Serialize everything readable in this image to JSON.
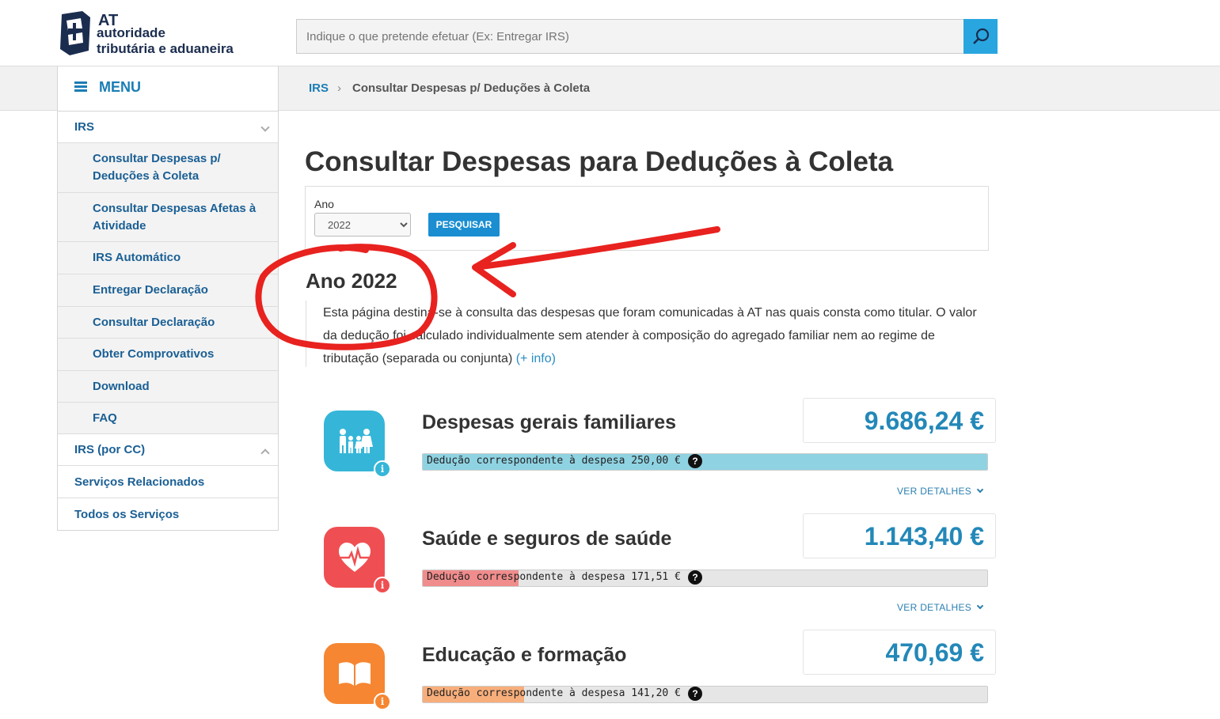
{
  "header": {
    "logo": {
      "abbr": "AT",
      "line1": "autoridade",
      "line2": "tributária e aduaneira"
    },
    "search": {
      "placeholder": "Indique o que pretende efetuar (Ex: Entregar IRS)"
    }
  },
  "breadcrumb": {
    "home": "IRS",
    "separator": "›",
    "current": "Consultar Despesas p/ Deduções à Coleta"
  },
  "sidebar": {
    "menu_label": "MENU",
    "sections": [
      {
        "label": "IRS",
        "expanded": true
      },
      {
        "label": "IRS (por CC)",
        "expanded": false
      },
      {
        "label": "Serviços Relacionados"
      },
      {
        "label": "Todos os Serviços"
      }
    ],
    "irs_items": [
      {
        "label": "Consultar Despesas p/ Deduções à Coleta"
      },
      {
        "label": "Consultar Despesas Afetas à Atividade"
      },
      {
        "label": "IRS Automático"
      },
      {
        "label": "Entregar Declaração"
      },
      {
        "label": "Consultar Declaração"
      },
      {
        "label": "Obter Comprovativos"
      },
      {
        "label": "Download"
      },
      {
        "label": "FAQ"
      }
    ]
  },
  "main": {
    "title": "Consultar Despesas para Deduções à Coleta",
    "filter": {
      "year_label": "Ano",
      "year_value": "2022",
      "search_button": "PESQUISAR"
    },
    "year_heading": "Ano 2022",
    "description": "Esta página destina-se à consulta das despesas que foram comunicadas à AT nas quais consta como titular. O valor da dedução foi calculado individualmente sem atender à composição do agregado familiar nem ao regime de tributação (separada ou conjunta)",
    "more_info": "(+ info)",
    "details_label": "VER DETALHES",
    "expenses": [
      {
        "title": "Despesas gerais familiares",
        "amount": "9.686,24 €",
        "deduction": "Dedução correspondente à despesa 250,00 €",
        "fill_fraction": 1.0,
        "color": "#35b6d8",
        "bar_color": "#8fd3e3",
        "icon": "family-icon"
      },
      {
        "title": "Saúde e seguros de saúde",
        "amount": "1.143,40 €",
        "deduction": "Dedução correspondente à despesa 171,51 €",
        "fill_fraction": 0.17,
        "color": "#ef4f52",
        "bar_color": "#f08c8c",
        "icon": "heart-icon"
      },
      {
        "title": "Educação e formação",
        "amount": "470,69 €",
        "deduction": "Dedução correspondente à despesa 141,20 €",
        "fill_fraction": 0.18,
        "color": "#f68632",
        "bar_color": "#f7ae7b",
        "icon": "book-icon"
      }
    ]
  },
  "colors": {
    "brand_blue": "#1a7db5",
    "button_blue": "#1a8ed1",
    "amount_blue": "#2388b8",
    "annotation_red": "#e8221f"
  }
}
